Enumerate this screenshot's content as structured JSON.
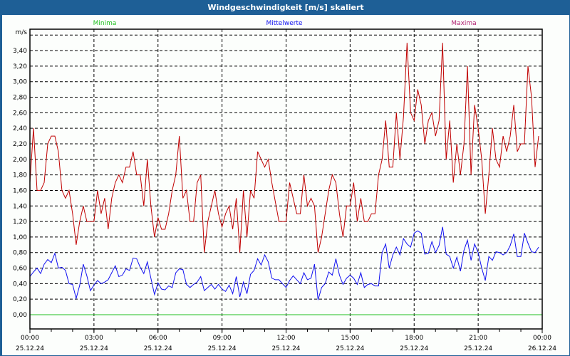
{
  "window": {
    "title": "Windgeschwindigkeit [m/s] skaliert"
  },
  "colors": {
    "minima": "#20c020",
    "mittelwerte": "#1010f0",
    "maxima": "#c00000",
    "maxima_legend": "#b02070",
    "grid": "#000000"
  },
  "chart_data": {
    "type": "line",
    "title": "Windgeschwindigkeit [m/s] skaliert",
    "ylabel": "m/s",
    "ylim": [
      0,
      3.6
    ],
    "y_ticks": [
      "0,00",
      "0,20",
      "0,40",
      "0,60",
      "0,80",
      "1,00",
      "1,20",
      "1,40",
      "1,60",
      "1,80",
      "2,00",
      "2,20",
      "2,40",
      "2,60",
      "2,80",
      "3,00",
      "3,20",
      "3,40"
    ],
    "x_range_hours": [
      0,
      24
    ],
    "x_interval_minutes": 10,
    "x_ticks": [
      {
        "time": "00:00",
        "date": "25.12.24"
      },
      {
        "time": "03:00",
        "date": "25.12.24"
      },
      {
        "time": "06:00",
        "date": "25.12.24"
      },
      {
        "time": "09:00",
        "date": "25.12.24"
      },
      {
        "time": "12:00",
        "date": "25.12.24"
      },
      {
        "time": "15:00",
        "date": "25.12.24"
      },
      {
        "time": "18:00",
        "date": "25.12.24"
      },
      {
        "time": "21:00",
        "date": "25.12.24"
      },
      {
        "time": "00:00",
        "date": "26.12.24"
      }
    ],
    "grid": true,
    "legend_placement": "top",
    "legend": [
      "Minima",
      "Mittelwerte",
      "Maxima"
    ],
    "series": [
      {
        "name": "Minima",
        "constant": 0
      },
      {
        "name": "Mittelwerte",
        "values": [
          0.49,
          0.55,
          0.6,
          0.53,
          0.65,
          0.71,
          0.67,
          0.79,
          0.6,
          0.61,
          0.57,
          0.4,
          0.39,
          0.21,
          0.38,
          0.65,
          0.5,
          0.31,
          0.38,
          0.44,
          0.4,
          0.42,
          0.45,
          0.54,
          0.63,
          0.49,
          0.51,
          0.59,
          0.57,
          0.73,
          0.72,
          0.61,
          0.53,
          0.68,
          0.47,
          0.26,
          0.41,
          0.33,
          0.32,
          0.37,
          0.35,
          0.54,
          0.59,
          0.58,
          0.39,
          0.35,
          0.39,
          0.42,
          0.49,
          0.31,
          0.35,
          0.39,
          0.33,
          0.39,
          0.33,
          0.3,
          0.38,
          0.27,
          0.49,
          0.23,
          0.42,
          0.27,
          0.52,
          0.57,
          0.72,
          0.64,
          0.77,
          0.68,
          0.47,
          0.45,
          0.45,
          0.4,
          0.35,
          0.44,
          0.5,
          0.45,
          0.4,
          0.54,
          0.45,
          0.47,
          0.65,
          0.19,
          0.35,
          0.4,
          0.55,
          0.51,
          0.72,
          0.51,
          0.39,
          0.47,
          0.51,
          0.47,
          0.39,
          0.54,
          0.35,
          0.39,
          0.4,
          0.37,
          0.37,
          0.8,
          0.91,
          0.6,
          0.77,
          0.87,
          0.77,
          0.98,
          0.91,
          0.87,
          1.05,
          1.08,
          1.05,
          0.78,
          0.79,
          0.94,
          0.8,
          0.89,
          1.13,
          0.78,
          0.75,
          0.6,
          0.74,
          0.56,
          0.83,
          0.96,
          0.7,
          0.91,
          0.8,
          0.6,
          0.44,
          0.75,
          0.7,
          0.81,
          0.8,
          0.77,
          0.8,
          0.89,
          1.04,
          0.75,
          0.75,
          1.05,
          0.92,
          0.81,
          0.8,
          0.87
        ]
      },
      {
        "name": "Maxima",
        "values": [
          1.7,
          2.4,
          1.6,
          1.6,
          1.7,
          2.2,
          2.3,
          2.3,
          2.1,
          1.6,
          1.5,
          1.6,
          1.3,
          0.9,
          1.2,
          1.4,
          1.2,
          1.2,
          1.2,
          1.6,
          1.3,
          1.5,
          1.1,
          1.5,
          1.7,
          1.8,
          1.7,
          1.9,
          1.9,
          2.1,
          1.8,
          1.8,
          1.4,
          2.0,
          1.4,
          1.0,
          1.25,
          1.1,
          1.1,
          1.3,
          1.6,
          1.8,
          2.3,
          1.5,
          1.6,
          1.2,
          1.2,
          1.7,
          1.8,
          0.8,
          1.2,
          1.4,
          1.6,
          1.3,
          1.13,
          1.3,
          1.4,
          1.1,
          1.5,
          0.8,
          1.6,
          1.0,
          1.6,
          1.5,
          2.1,
          2.0,
          1.9,
          2.0,
          1.7,
          1.45,
          1.2,
          1.2,
          1.2,
          1.7,
          1.5,
          1.3,
          1.3,
          1.8,
          1.4,
          1.5,
          1.4,
          0.8,
          1.0,
          1.3,
          1.6,
          1.8,
          1.7,
          1.3,
          1.0,
          1.4,
          1.4,
          1.7,
          1.2,
          1.5,
          1.2,
          1.2,
          1.3,
          1.3,
          1.8,
          2.0,
          2.5,
          1.9,
          1.9,
          2.6,
          2.0,
          2.55,
          3.5,
          2.6,
          2.5,
          2.9,
          2.7,
          2.2,
          2.5,
          2.6,
          2.3,
          2.5,
          3.5,
          2.0,
          2.5,
          1.7,
          2.2,
          1.8,
          2.2,
          3.2,
          1.8,
          2.7,
          2.4,
          2.0,
          1.3,
          1.8,
          2.4,
          2.0,
          1.9,
          2.3,
          2.1,
          2.3,
          2.7,
          2.1,
          2.2,
          2.2,
          3.2,
          2.8,
          1.9,
          2.3
        ]
      }
    ]
  }
}
